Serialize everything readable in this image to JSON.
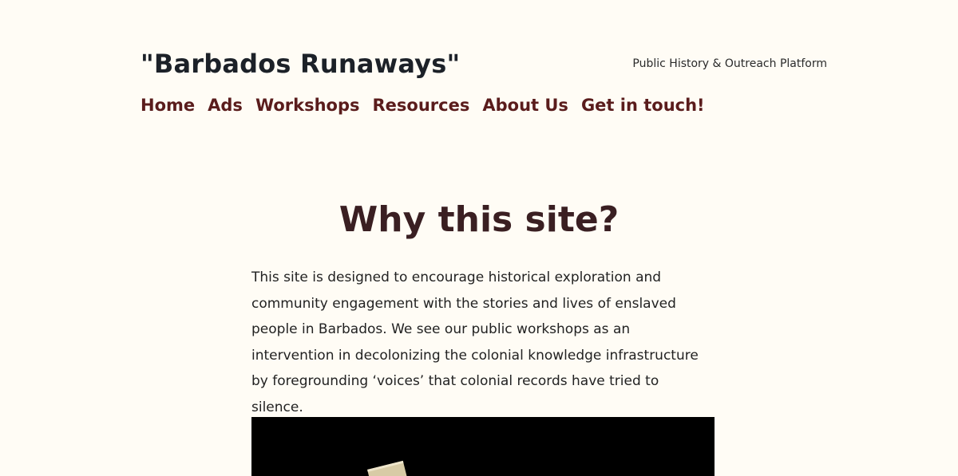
{
  "site": {
    "title": "\"Barbados Runaways\"",
    "tagline": "Public History & Outreach Platform"
  },
  "nav": {
    "items": [
      {
        "label": "Home"
      },
      {
        "label": "Ads"
      },
      {
        "label": "Workshops"
      },
      {
        "label": "Resources"
      },
      {
        "label": "About Us"
      },
      {
        "label": "Get in touch!"
      }
    ]
  },
  "main": {
    "heading": "Why this site?",
    "intro": "This site is designed to encourage historical exploration and community engagement with the stories and lives of enslaved people in Barbados. We see our public workshops as an intervention in decolonizing the colonial knowledge infrastructure by foregrounding ‘voices’ that colonial records have tried to silence."
  },
  "colors": {
    "background": "#fffcf5",
    "nav_link": "#5a1c1c",
    "heading": "#3a1f22",
    "title": "#1c2128"
  }
}
